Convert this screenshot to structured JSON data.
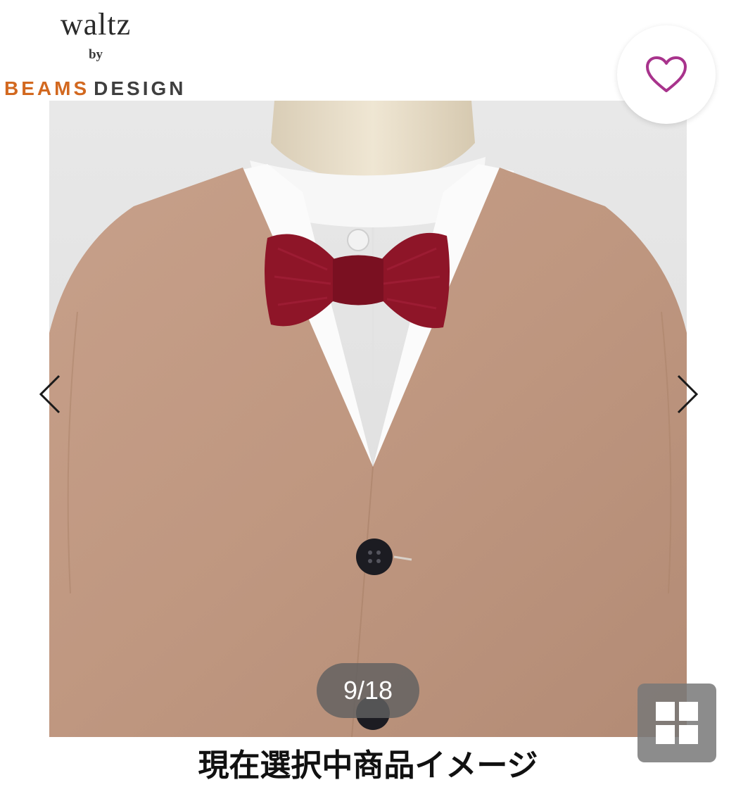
{
  "brand": {
    "name": "waltz",
    "by": "by",
    "beams": "BEAMS",
    "design": "DESIGN",
    "beams_color": "#d2681f"
  },
  "favorite": {
    "icon": "heart-outline-icon",
    "color": "#a8338c"
  },
  "gallery": {
    "image": "product-photo",
    "prev_icon": "chevron-left-icon",
    "next_icon": "chevron-right-icon",
    "counter": "9/18",
    "current": 9,
    "total": 18,
    "grid_icon": "grid-icon"
  },
  "caption": "現在選択中商品イメージ"
}
